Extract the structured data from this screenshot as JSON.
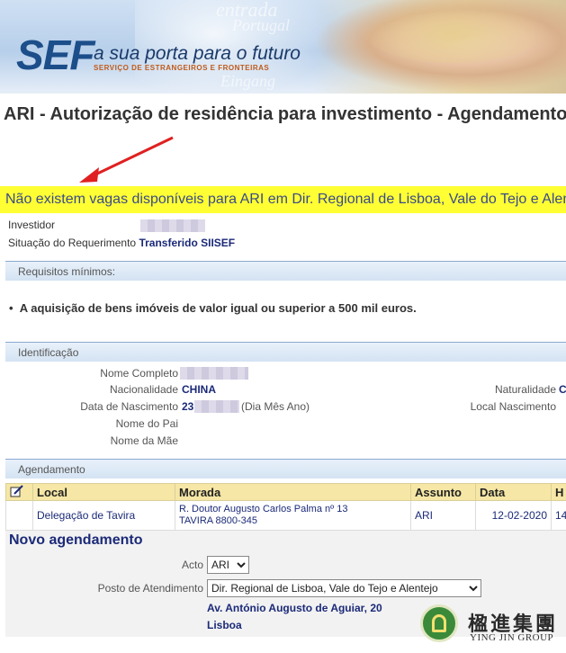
{
  "banner": {
    "logo": "SEF",
    "tagline": "a sua porta para o futuro",
    "subtitle": "SERVIÇO DE ESTRANGEIROS E FRONTEIRAS",
    "ghost_words": [
      "entrada",
      "Portugal",
      "Eingang"
    ]
  },
  "page_title": "ARI - Autorização de residência para investimento - Agendamento",
  "warning": "Não existem vagas disponíveis para ARI em Dir. Regional de Lisboa, Vale do Tejo e Alentejo",
  "requerente": {
    "investidor_label": "Investidor",
    "situacao_label": "Situação do Requerimento",
    "situacao_value": "Transferido SIISEF"
  },
  "requisitos": {
    "header": "Requisitos mínimos:",
    "items": [
      "A aquisição de bens imóveis de valor igual ou superior a 500 mil euros."
    ]
  },
  "identificacao": {
    "header": "Identificação",
    "nome_label": "Nome Completo",
    "nacionalidade_label": "Nacionalidade",
    "nacionalidade_value": "CHINA",
    "nascimento_label": "Data de Nascimento",
    "nascimento_value_prefix": "23",
    "nascimento_hint": "(Dia Mês Ano)",
    "pai_label": "Nome do Pai",
    "mae_label": "Nome da Mãe",
    "naturalidade_label": "Naturalidade",
    "naturalidade_value": "C",
    "local_nascimento_label": "Local Nascimento"
  },
  "agendamento": {
    "header": "Agendamento",
    "columns": [
      "Local",
      "Morada",
      "Assunto",
      "Data",
      "H"
    ],
    "rows": [
      {
        "local": "Delegação de Tavira",
        "morada_line1": "R. Doutor Augusto Carlos Palma nº 13",
        "morada_line2": "TAVIRA 8800-345",
        "assunto": "ARI",
        "data": "12-02-2020",
        "hora": "14"
      }
    ]
  },
  "novo": {
    "title": "Novo agendamento",
    "acto_label": "Acto",
    "acto_value": "ARI",
    "posto_label": "Posto de Atendimento",
    "posto_value": "Dir. Regional de Lisboa, Vale do Tejo e Alentejo",
    "address_line1": "Av. António Augusto de Aguiar, 20",
    "address_line2": "Lisboa"
  },
  "watermark": {
    "cn": "楹進集團",
    "en": "YING JIN GROUP"
  },
  "colors": {
    "accent_blue": "#1b2a78",
    "warning_bg": "#ffff33",
    "table_header_bg": "#f6e7a6",
    "arrow_red": "#e02020"
  }
}
